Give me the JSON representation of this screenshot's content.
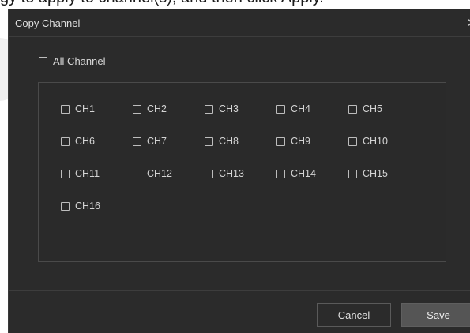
{
  "background": {
    "text": "gy to apply to channel(s), and then click Apply."
  },
  "dialog": {
    "title": "Copy Channel",
    "close_icon": "close-icon",
    "all_channel_label": "All Channel",
    "channels": [
      "CH1",
      "CH2",
      "CH3",
      "CH4",
      "CH5",
      "CH6",
      "CH7",
      "CH8",
      "CH9",
      "CH10",
      "CH11",
      "CH12",
      "CH13",
      "CH14",
      "CH15",
      "CH16"
    ],
    "cancel_label": "Cancel",
    "save_label": "Save"
  }
}
